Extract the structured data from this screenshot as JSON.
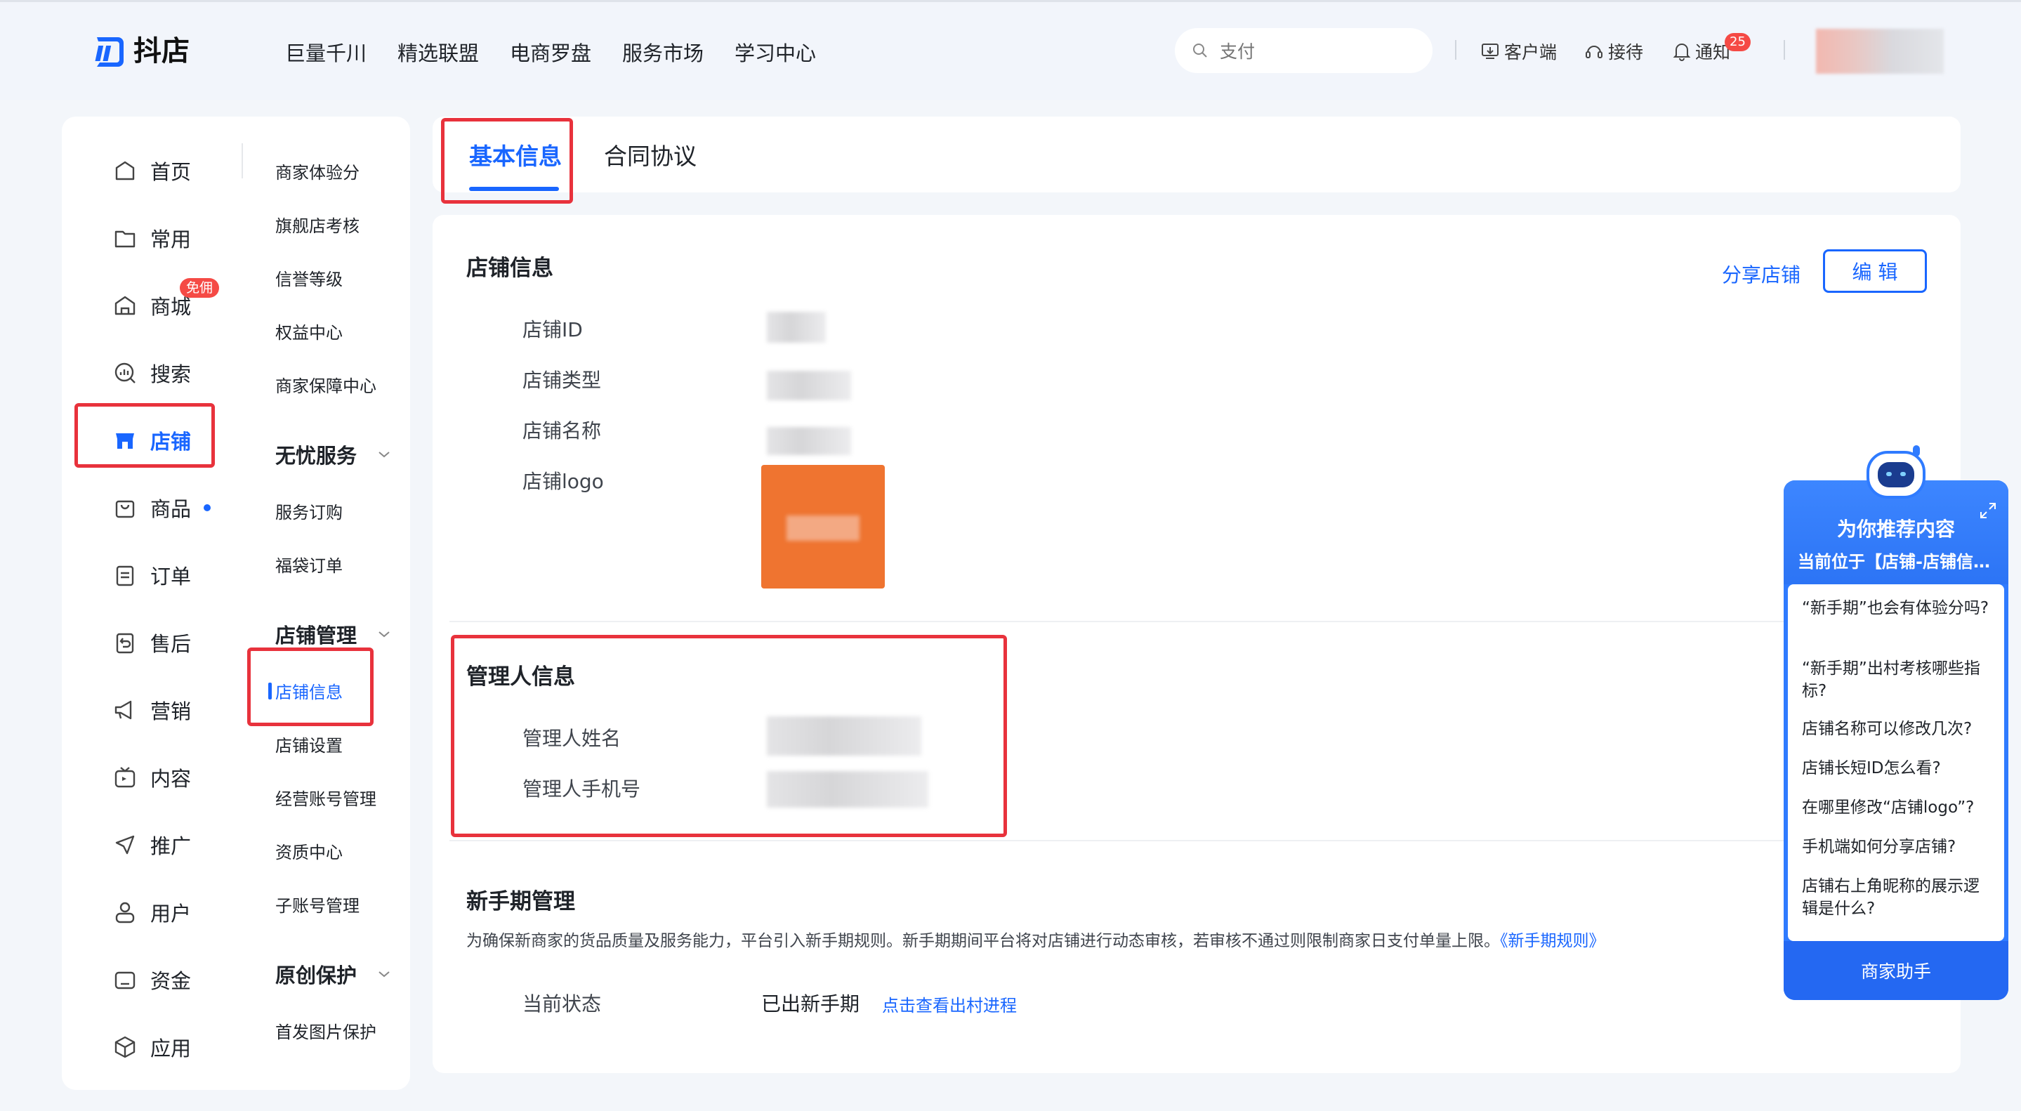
{
  "header": {
    "logo_text": "抖店",
    "nav": [
      "巨量千川",
      "精选联盟",
      "电商罗盘",
      "服务市场",
      "学习中心"
    ],
    "search_placeholder": "支付",
    "client_label": "客户端",
    "reception_label": "接待",
    "notify_label": "通知",
    "notify_count": "25"
  },
  "sidebar": {
    "primary": [
      {
        "label": "首页",
        "icon": "home-icon"
      },
      {
        "label": "常用",
        "icon": "folder-icon"
      },
      {
        "label": "商城",
        "icon": "mall-icon",
        "badge": "免佣"
      },
      {
        "label": "搜索",
        "icon": "search-chart-icon"
      },
      {
        "label": "店铺",
        "icon": "store-icon",
        "active": true
      },
      {
        "label": "商品",
        "icon": "bag-icon",
        "dot": true
      },
      {
        "label": "订单",
        "icon": "order-icon"
      },
      {
        "label": "售后",
        "icon": "aftersale-icon"
      },
      {
        "label": "营销",
        "icon": "megaphone-icon"
      },
      {
        "label": "内容",
        "icon": "tv-icon"
      },
      {
        "label": "推广",
        "icon": "promote-icon"
      },
      {
        "label": "用户",
        "icon": "user-icon"
      },
      {
        "label": "资金",
        "icon": "wallet-icon"
      },
      {
        "label": "应用",
        "icon": "cube-icon"
      }
    ],
    "secondary": {
      "items_top": [
        "商家体验分",
        "旗舰店考核",
        "信誉等级",
        "权益中心",
        "商家保障中心"
      ],
      "group1": "无忧服务",
      "group1_items": [
        "服务订购",
        "福袋订单"
      ],
      "group2": "店铺管理",
      "group2_items": [
        "店铺信息",
        "店铺设置",
        "经营账号管理",
        "资质中心",
        "子账号管理"
      ],
      "group3": "原创保护",
      "group3_items": [
        "首发图片保护"
      ]
    }
  },
  "tabs": [
    "基本信息",
    "合同协议"
  ],
  "store_info": {
    "title": "店铺信息",
    "share_label": "分享店铺",
    "edit_label": "编 辑",
    "fields": [
      "店铺ID",
      "店铺类型",
      "店铺名称",
      "店铺logo"
    ],
    "logo_color": "#ef7430"
  },
  "manager_info": {
    "title": "管理人信息",
    "fields": [
      "管理人姓名",
      "管理人手机号"
    ]
  },
  "newbie": {
    "title": "新手期管理",
    "desc": "为确保新商家的货品质量及服务能力，平台引入新手期规则。新手期期间平台将对店铺进行动态审核，若审核不通过则限制商家日支付单量上限。",
    "rule_link": "《新手期规则》",
    "status_label": "当前状态",
    "status_value": "已出新手期",
    "progress_link": "点击查看出村进程"
  },
  "assistant": {
    "title": "为你推荐内容",
    "subtitle": "当前位于【店铺-店铺信息】",
    "questions": [
      "“新手期”也会有体验分吗?",
      "“新手期”出村考核哪些指标?",
      "店铺名称可以修改几次?",
      "店铺长短ID怎么看?",
      "在哪里修改“店铺logo”?",
      "手机端如何分享店铺?",
      "店铺右上角昵称的展示逻辑是什么?"
    ],
    "button_label": "商家助手"
  },
  "colors": {
    "accent": "#1966ff",
    "highlight": "#e8323c",
    "badge": "#f54a45"
  }
}
